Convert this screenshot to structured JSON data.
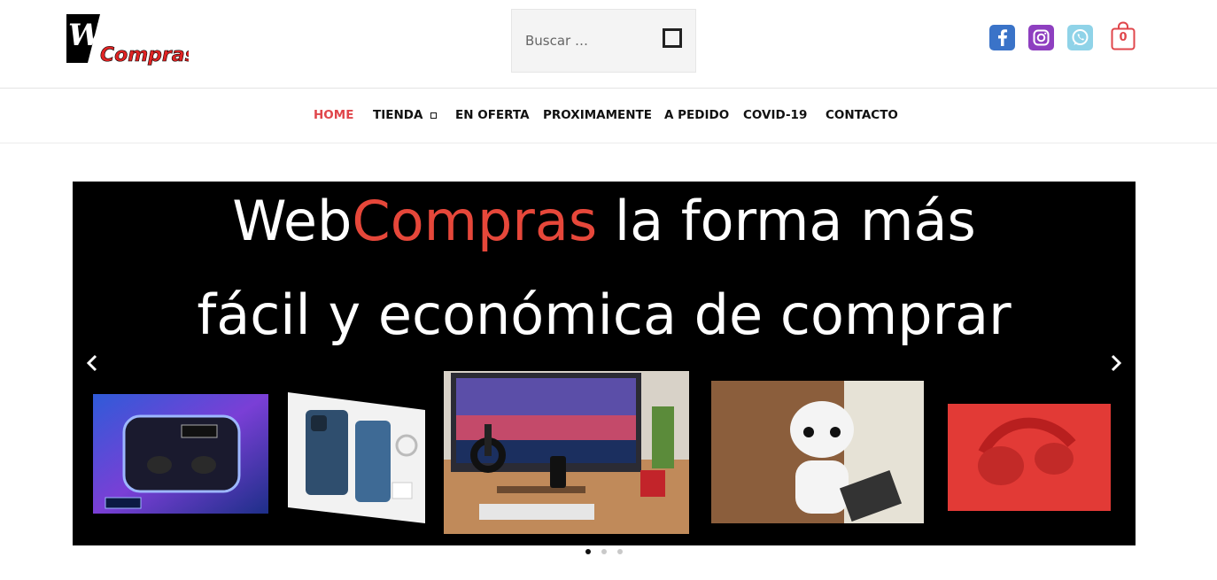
{
  "header": {
    "logo": {
      "word1": "Web",
      "word2": "Compras"
    },
    "search": {
      "placeholder": "Buscar …",
      "value": ""
    },
    "social": [
      "facebook-icon",
      "instagram-icon",
      "whatsapp-icon"
    ],
    "cart": {
      "count": "0"
    },
    "colors": {
      "accent": "#e0464b",
      "facebook": "#3a73c8",
      "instagram": "#8e3fc0",
      "whatsapp": "#8fd3e8"
    }
  },
  "nav": {
    "items": [
      {
        "label": "HOME"
      },
      {
        "label": "TIENDA"
      },
      {
        "label": "EN OFERTA"
      },
      {
        "label": "PROXIMAMENTE"
      },
      {
        "label": "A PEDIDO"
      },
      {
        "label": "COVID-19"
      },
      {
        "label": "CONTACTO"
      }
    ]
  },
  "slider": {
    "line1_prefix": "Web",
    "line1_accent": "Compras",
    "line1_suffix": " la forma más",
    "line2": "fácil y económica de comprar",
    "products": [
      "earbuds",
      "iphone",
      "desk-setup",
      "robot",
      "headphones"
    ],
    "slide_count": 3,
    "active_slide": 1
  }
}
